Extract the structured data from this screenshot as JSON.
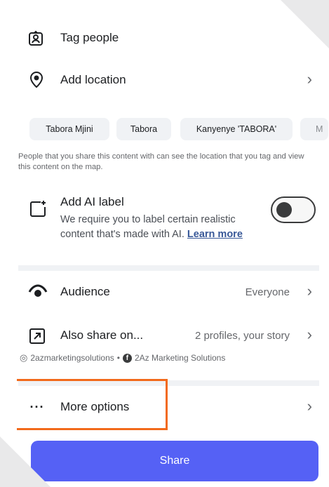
{
  "tag_people": {
    "label": "Tag people",
    "icon": "tag-person-icon"
  },
  "add_location": {
    "label": "Add location",
    "icon": "location-pin-icon"
  },
  "location_chips": [
    "Tabora Mjini",
    "Tabora",
    "Kanyenye 'TABORA'",
    "M"
  ],
  "location_hint": "People that you share this content with can see the location that you tag and view this content on the map.",
  "ai_label": {
    "title": "Add AI label",
    "description": "We require you to label certain realistic content that's made with AI.",
    "link": "Learn more",
    "toggle_on": false
  },
  "audience": {
    "label": "Audience",
    "value": "Everyone",
    "icon": "eye-icon"
  },
  "also_share": {
    "label": "Also share on...",
    "value": "2 profiles, your story",
    "instagram_account": "2azmarketingsolutions",
    "separator": "•",
    "facebook_page": "2Az Marketing Solutions",
    "icon": "share-arrow-icon"
  },
  "more_options": {
    "label": "More options",
    "icon": "more-dots-icon"
  },
  "share_button": {
    "label": "Share"
  },
  "colors": {
    "accent": "#5561f5",
    "highlight": "#f26a1b",
    "link": "#385898"
  }
}
